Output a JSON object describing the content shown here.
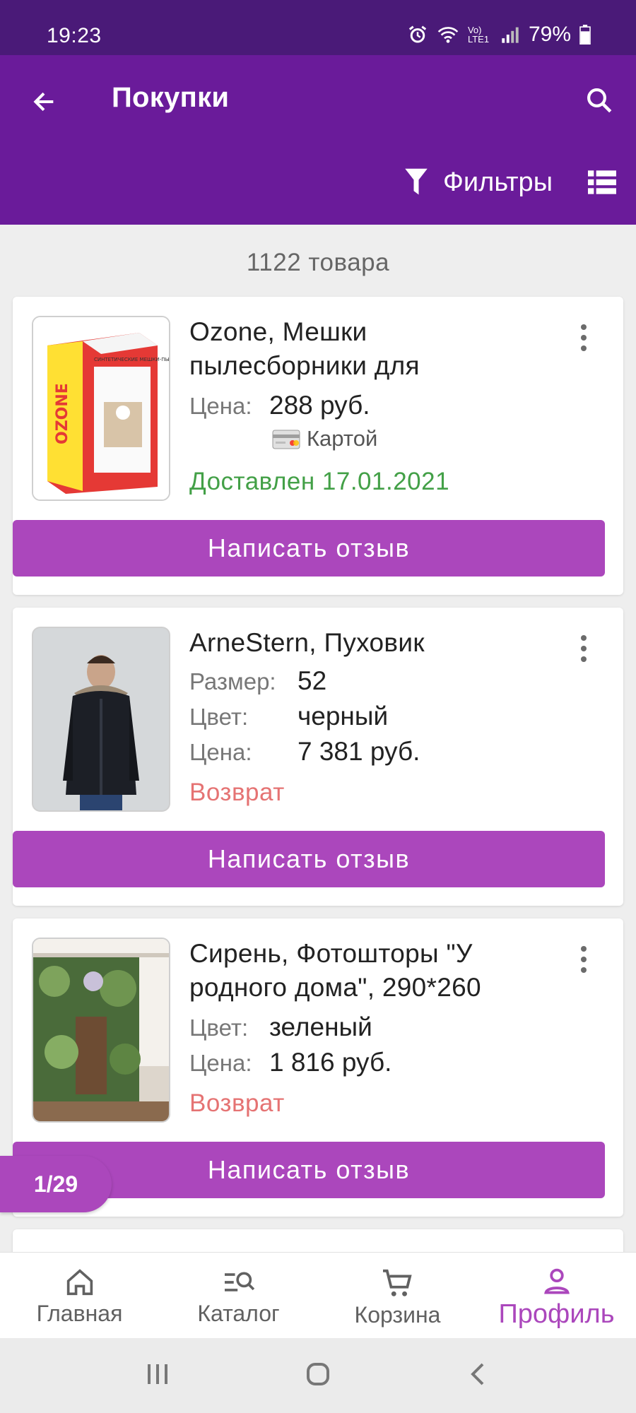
{
  "status_bar": {
    "time": "19:23",
    "network": "Vo) LTE1",
    "battery": "79%"
  },
  "header": {
    "title": "Покупки",
    "filters_label": "Фильтры"
  },
  "count_label": "1122 товара",
  "items": [
    {
      "title_line1": "Ozone, Мешки",
      "title_line2": "пылесборники для",
      "price_label": "Цена:",
      "price": "288 руб.",
      "payment": "Картой",
      "status": "Доставлен 17.01.2021",
      "review_label": "Написать отзыв",
      "image_text_brand": "OZONE",
      "image_text_caption": "СИНТЕТИЧЕСКИЕ МЕШКИ-ПЫЛЕСБОРНИКИ"
    },
    {
      "title_line1": "ArneStern, Пуховик",
      "size_label": "Размер:",
      "size": "52",
      "color_label": "Цвет:",
      "color": "черный",
      "price_label": "Цена:",
      "price": "7 381 руб.",
      "status": "Возврат",
      "review_label": "Написать отзыв"
    },
    {
      "title_line1": "Сирень, Фотошторы \"У",
      "title_line2": "родного дома\", 290*260",
      "color_label": "Цвет:",
      "color": "зеленый",
      "price_label": "Цена:",
      "price": "1 816 руб.",
      "status": "Возврат",
      "review_label": "Написать отзыв"
    }
  ],
  "page_badge": "1/29",
  "bottom_nav": [
    {
      "label": "Главная",
      "icon": "home-icon"
    },
    {
      "label": "Каталог",
      "icon": "catalog-search-icon"
    },
    {
      "label": "Корзина",
      "icon": "cart-icon"
    },
    {
      "label": "Профиль",
      "icon": "profile-icon",
      "active": true
    }
  ],
  "colors": {
    "status_bar": "#4a1a78",
    "app_bar": "#6a1b9a",
    "accent": "#ab47bc",
    "delivered": "#43a047",
    "return": "#e57373"
  }
}
